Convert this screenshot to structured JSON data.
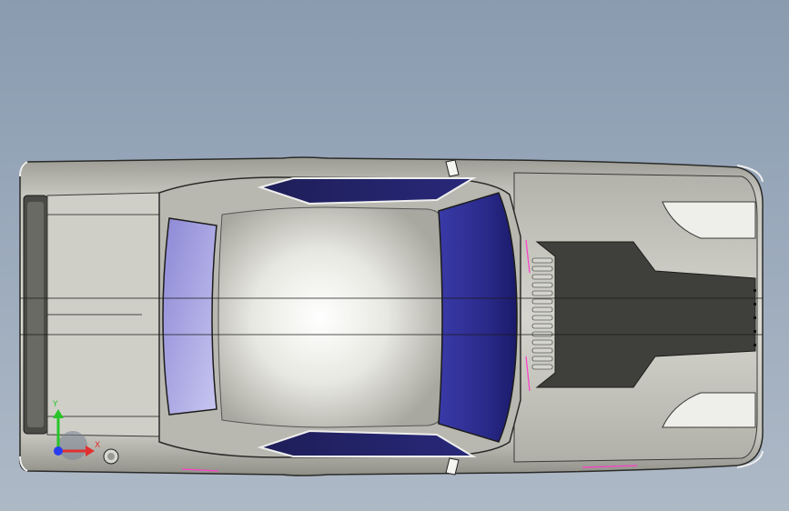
{
  "viewport": {
    "background_top": "#8a9bb0",
    "background_bottom": "#aeb9c6"
  },
  "model": {
    "body_color": "#c9c9c1",
    "glass_color": "#2a2a80",
    "stripe_color": "#3f403c",
    "edge_highlight": "#ff3cc8"
  },
  "triad": {
    "y_label": "Y",
    "x_label": "X",
    "y_color": "#27c427",
    "x_color": "#e23030",
    "z_color": "#2a3cf0"
  }
}
